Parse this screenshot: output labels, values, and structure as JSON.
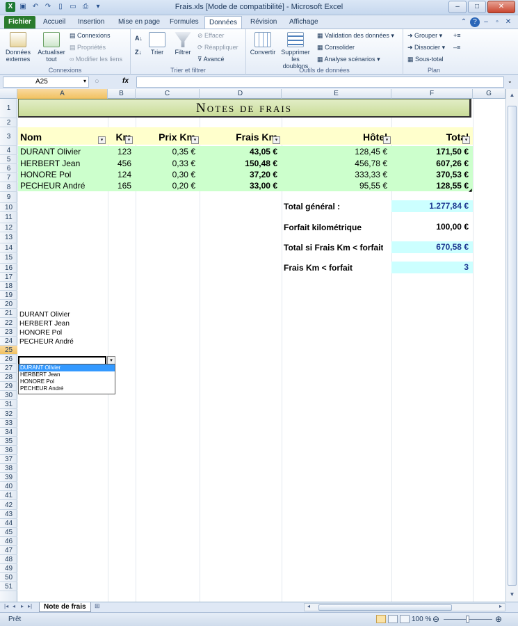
{
  "window": {
    "title": "Frais.xls  [Mode de compatibilité]  -  Microsoft Excel"
  },
  "tabs": [
    "Fichier",
    "Accueil",
    "Insertion",
    "Mise en page",
    "Formules",
    "Données",
    "Révision",
    "Affichage"
  ],
  "active_tab": "Données",
  "ribbon": {
    "connexions": {
      "externes": "Données externes",
      "actualiser": "Actualiser tout",
      "connexions": "Connexions",
      "proprietes": "Propriétés",
      "modifier_liens": "Modifier les liens",
      "label": "Connexions"
    },
    "trier": {
      "trier": "Trier",
      "filtrer": "Filtrer",
      "effacer": "Effacer",
      "reappliquer": "Réappliquer",
      "avance": "Avancé",
      "label": "Trier et filtrer"
    },
    "outils": {
      "convertir": "Convertir",
      "supprimer": "Supprimer les doublons",
      "validation": "Validation des données",
      "consolider": "Consolider",
      "analyse": "Analyse scénarios",
      "label": "Outils de données"
    },
    "plan": {
      "grouper": "Grouper",
      "dissocier": "Dissocier",
      "sous_total": "Sous-total",
      "label": "Plan"
    }
  },
  "formula_bar": {
    "name_box": "A25",
    "fx": "fx",
    "formula": ""
  },
  "columns": [
    "A",
    "B",
    "C",
    "D",
    "E",
    "F",
    "G"
  ],
  "selected_column": "A",
  "selected_row": 25,
  "sheet": {
    "banner": "Notes de frais",
    "headers": {
      "nom": "Nom",
      "km": "Km",
      "prix_km": "Prix Km",
      "frais_km": "Frais Km",
      "hotel": "Hôtel",
      "total": "Total"
    },
    "rows": [
      {
        "nom": "DURANT Olivier",
        "km": "123",
        "prix_km": "0,35 €",
        "frais_km": "43,05 €",
        "hotel": "128,45 €",
        "total": "171,50 €"
      },
      {
        "nom": "HERBERT Jean",
        "km": "456",
        "prix_km": "0,33 €",
        "frais_km": "150,48 €",
        "hotel": "456,78 €",
        "total": "607,26 €"
      },
      {
        "nom": "HONORE Pol",
        "km": "124",
        "prix_km": "0,30 €",
        "frais_km": "37,20 €",
        "hotel": "333,33 €",
        "total": "370,53 €"
      },
      {
        "nom": "PECHEUR André",
        "km": "165",
        "prix_km": "0,20 €",
        "frais_km": "33,00 €",
        "hotel": "95,55 €",
        "total": "128,55 €"
      }
    ],
    "summary": [
      {
        "label": "Total général :",
        "value": "1.277,84 €"
      },
      {
        "label": "Forfait kilométrique",
        "value": "100,00 €"
      },
      {
        "label": "Total si Frais Km < forfait",
        "value": "670,58 €"
      },
      {
        "label": "Frais Km < forfait",
        "value": "3"
      }
    ],
    "name_list": [
      "DURANT Olivier",
      "HERBERT Jean",
      "HONORE Pol",
      "PECHEUR André"
    ],
    "dropdown_options": [
      "DURANT Olivier",
      "HERBERT Jean",
      "HONORE Pol",
      "PECHEUR André"
    ]
  },
  "sheet_tab": "Note de frais",
  "status": {
    "mode": "Prêt",
    "zoom": "100 %"
  }
}
